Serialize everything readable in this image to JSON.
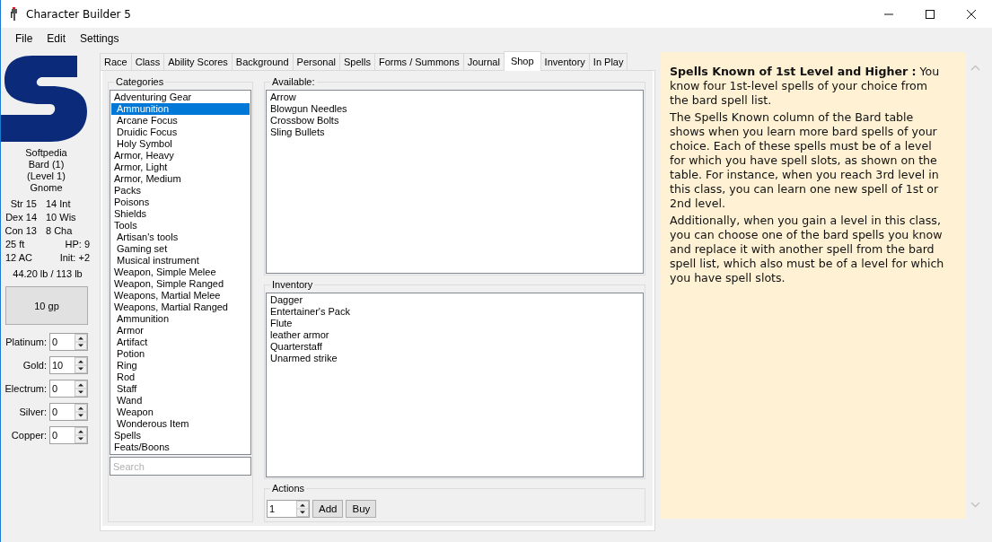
{
  "window": {
    "title": "Character Builder 5"
  },
  "menu": [
    "File",
    "Edit",
    "Settings"
  ],
  "character": {
    "portrait": {
      "kind": "picture"
    },
    "lines": [
      "Softpedia",
      "Bard (1)",
      "(Level 1)",
      "Gnome"
    ],
    "stats": [
      {
        "kind": "ability",
        "left": "Str 15",
        "right": "14 Int"
      },
      {
        "kind": "ability",
        "left": "Dex 14",
        "right": "10 Wis"
      },
      {
        "kind": "ability",
        "left": "Con 13",
        "right": "8 Cha"
      },
      {
        "kind": "derived",
        "left": "25 ft",
        "right": "HP: 9"
      },
      {
        "kind": "derived",
        "left": "12 AC",
        "right": "Init: +2"
      }
    ],
    "weight": "44.20 lb / 113 lb",
    "money": "10 gp",
    "coins": [
      {
        "label": "Platinum:",
        "value": "0"
      },
      {
        "label": "Gold:",
        "value": "10"
      },
      {
        "label": "Electrum:",
        "value": "0"
      },
      {
        "label": "Silver:",
        "value": "0"
      },
      {
        "label": "Copper:",
        "value": "0"
      }
    ]
  },
  "tabs": [
    {
      "label": "Race",
      "selected": false
    },
    {
      "label": "Class",
      "selected": false
    },
    {
      "label": "Ability Scores",
      "selected": false
    },
    {
      "label": "Background",
      "selected": false
    },
    {
      "label": "Personal",
      "selected": false
    },
    {
      "label": "Spells",
      "selected": false
    },
    {
      "label": "Forms / Summons",
      "selected": false
    },
    {
      "label": "Journal",
      "selected": false
    },
    {
      "label": "Shop",
      "selected": true
    },
    {
      "label": "Inventory",
      "selected": false
    },
    {
      "label": "In Play",
      "selected": false
    }
  ],
  "shop": {
    "categories": {
      "title": "Categories",
      "items": [
        {
          "label": "Adventuring Gear",
          "selected": false,
          "children": [
            {
              "label": "Ammunition",
              "selected": true
            },
            {
              "label": "Arcane Focus",
              "selected": false
            },
            {
              "label": "Druidic Focus",
              "selected": false
            },
            {
              "label": "Holy Symbol",
              "selected": false
            }
          ]
        },
        {
          "label": "Armor, Heavy",
          "selected": false
        },
        {
          "label": "Armor, Light",
          "selected": false
        },
        {
          "label": "Armor, Medium",
          "selected": false
        },
        {
          "label": "Packs",
          "selected": false
        },
        {
          "label": "Poisons",
          "selected": false
        },
        {
          "label": "Shields",
          "selected": false
        },
        {
          "label": "Tools",
          "selected": false,
          "children": [
            {
              "label": "Artisan's tools",
              "selected": false
            },
            {
              "label": "Gaming set",
              "selected": false
            },
            {
              "label": "Musical instrument",
              "selected": false
            }
          ]
        },
        {
          "label": "Weapon, Simple Melee",
          "selected": false
        },
        {
          "label": "Weapon, Simple Ranged",
          "selected": false
        },
        {
          "label": "Weapons, Martial Melee",
          "selected": false
        },
        {
          "label": "Weapons, Martial Ranged",
          "selected": false,
          "children": [
            {
              "label": "Ammunition",
              "selected": false
            },
            {
              "label": "Armor",
              "selected": false
            },
            {
              "label": "Artifact",
              "selected": false
            },
            {
              "label": "Potion",
              "selected": false
            },
            {
              "label": "Ring",
              "selected": false
            },
            {
              "label": "Rod",
              "selected": false
            },
            {
              "label": "Staff",
              "selected": false
            },
            {
              "label": "Wand",
              "selected": false
            },
            {
              "label": "Weapon",
              "selected": false
            },
            {
              "label": "Wonderous Item",
              "selected": false
            }
          ]
        },
        {
          "label": "Spells",
          "selected": false
        },
        {
          "label": "Feats/Boons",
          "selected": false
        }
      ],
      "search": {
        "placeholder": "Search"
      }
    },
    "available": {
      "title": "Available:",
      "items": [
        "Arrow",
        "Blowgun Needles",
        "Crossbow Bolts",
        "Sling Bullets"
      ]
    },
    "inventory": {
      "title": "Inventory",
      "items": [
        "Dagger",
        "Entertainer's Pack",
        "Flute",
        "leather armor",
        "Quarterstaff",
        "Unarmed strike"
      ]
    },
    "actions": {
      "title": "Actions",
      "quantity": "1",
      "buttons": [
        "Add",
        "Buy"
      ]
    }
  },
  "info": {
    "paragraphs": [
      "**Spells Known of 1st Level and Higher :** You know four 1st-level spells of your choice from the bard spell list.",
      "The Spells Known column of the Bard table shows when you learn more bard spells of your choice. Each of these spells must be of a level for which you have spell slots, as shown on the table. For instance, when you reach 3rd level in this class, you can learn one new spell of 1st or 2nd level.",
      "Additionally, when you gain a level in this class, you can choose one of the bard spells you know and replace it with another spell from the bard spell list, which also must be of a level for which you have spell slots."
    ]
  }
}
